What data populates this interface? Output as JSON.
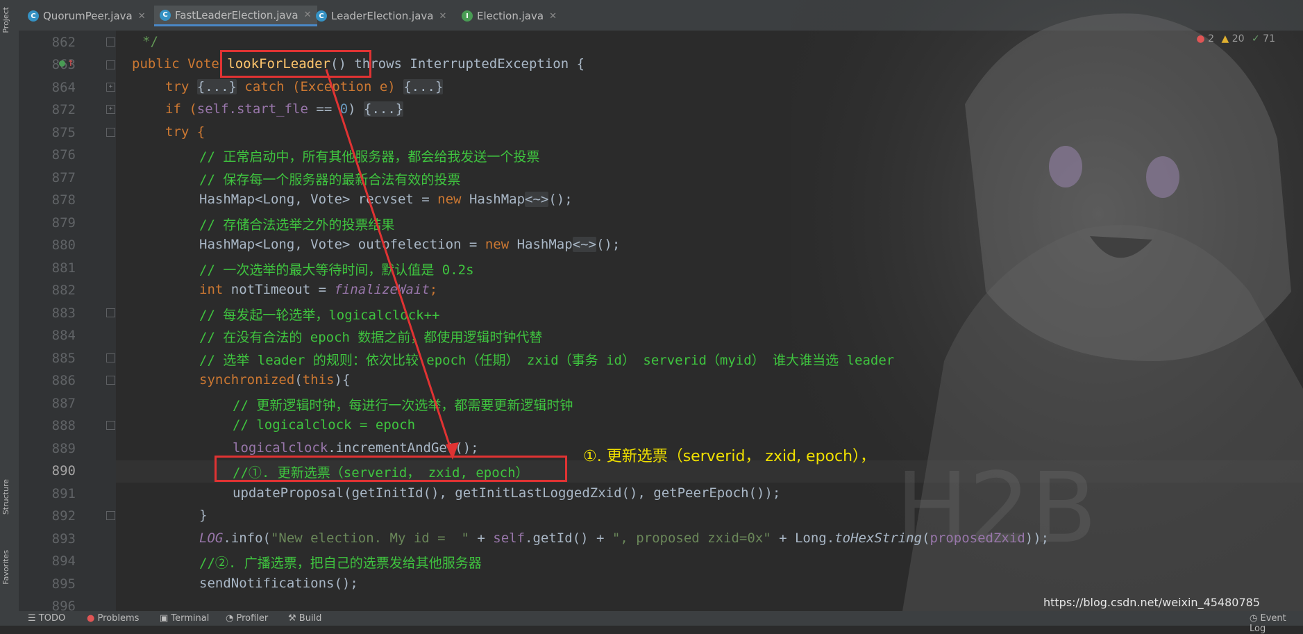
{
  "sidebar": {
    "project_label": "Project",
    "structure_label": "Structure",
    "favorites_label": "Favorites"
  },
  "tabs": [
    {
      "label": "QuorumPeer.java",
      "icon": "c-class-icon",
      "active": false
    },
    {
      "label": "FastLeaderElection.java",
      "icon": "c-class-icon",
      "active": true
    },
    {
      "label": "LeaderElection.java",
      "icon": "c-class-icon",
      "active": false
    },
    {
      "label": "Election.java",
      "icon": "interface-icon",
      "active": false
    }
  ],
  "inspections": {
    "errors": "2",
    "warnings": "20",
    "weak_warnings": "71"
  },
  "line_numbers": [
    "862",
    "863",
    "864",
    "872",
    "875",
    "876",
    "877",
    "878",
    "879",
    "880",
    "881",
    "882",
    "883",
    "884",
    "885",
    "886",
    "887",
    "888",
    "889",
    "890",
    "891",
    "892",
    "893",
    "894",
    "895",
    "896"
  ],
  "current_line": "890",
  "code": {
    "l862": "*/",
    "l863_pub": "public Vote ",
    "l863_fn": "lookForLeader",
    "l863_rest": "() throws InterruptedException {",
    "l864_try": "try ",
    "l864_b1": "{...}",
    "l864_catch": " catch (Exception e) ",
    "l864_b2": "{...}",
    "l872_if": "if (",
    "l872_self": "self",
    "l872_start": ".start_fle ",
    "l872_op": "==",
    "l872_zero": " 0",
    "l872_close": ") ",
    "l872_b": "{...}",
    "l875": "try {",
    "l876": "// 正常启动中，所有其他服务器，都会给我发送一个投票",
    "l877": "// 保存每一个服务器的最新合法有效的投票",
    "l878_a": "HashMap<Long, Vote> recvset = ",
    "l878_new": "new",
    "l878_b": " HashMap",
    "l878_c": "<~>",
    "l878_d": "();",
    "l879": "// 存储合法选举之外的投票结果",
    "l880_a": "HashMap<Long, Vote> outofelection = ",
    "l880_new": "new",
    "l880_b": " HashMap",
    "l880_c": "<~>",
    "l880_d": "();",
    "l881": "// 一次选举的最大等待时间，默认值是 0.2s",
    "l882_int": "int",
    "l882_a": " notTimeout = ",
    "l882_b": "finalizeWait",
    "l882_c": ";",
    "l883": "// 每发起一轮选举，logicalclock++",
    "l884": "// 在没有合法的 epoch 数据之前，都使用逻辑时钟代替",
    "l885": "// 选举 leader 的规则：依次比较 epoch（任期） zxid（事务 id） serverid（myid） 谁大谁当选 leader",
    "l886_a": "synchronized",
    "l886_b": "(",
    "l886_c": "this",
    "l886_d": "){",
    "l887": "// 更新逻辑时钟，每进行一次选举，都需要更新逻辑时钟",
    "l888": "// logicalclock = epoch",
    "l889_a": "logicalclock",
    "l889_b": ".incrementAndGet();",
    "l890": "//①. 更新选票（serverid， zxid, epoch）",
    "l891": "updateProposal(getInitId(), getInitLastLoggedZxid(), getPeerEpoch());",
    "l892": "}",
    "l893_log": "LOG",
    "l893_a": ".info(",
    "l893_s1": "\"New election. My id =  \"",
    "l893_b": " + ",
    "l893_self": "self",
    "l893_c": ".getId() + ",
    "l893_s2": "\", proposed zxid=0x\"",
    "l893_d": " + Long.",
    "l893_hex": "toHexString",
    "l893_e": "(",
    "l893_pz": "proposedZxid",
    "l893_f": "));",
    "l894": "//②. 广播选票，把自己的选票发给其他服务器",
    "l895": "sendNotifications();"
  },
  "annotation": "①. 更新选票（serverid， zxid, epoch），",
  "watermark": "https://blog.csdn.net/weixin_45480785",
  "statusbar": [
    "TODO",
    "Problems",
    "Terminal",
    "Profiler",
    "Build",
    "Event Log"
  ],
  "colors": {
    "keyword": "#cc7832",
    "comment": "#3fc43f",
    "string": "#6a8759",
    "highlight_box": "#e03333",
    "annotation": "#f0e000"
  }
}
